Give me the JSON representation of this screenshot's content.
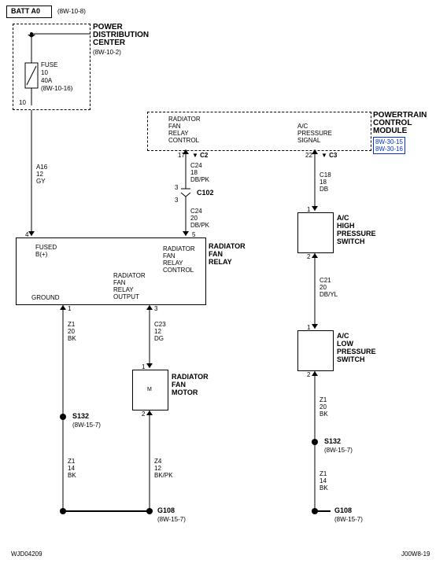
{
  "header": {
    "title": "BATT A0",
    "ref": "(8W-10-8)"
  },
  "pdc": {
    "title": "POWER\nDISTRIBUTION\nCENTER",
    "ref": "(8W-10-2)",
    "fuse": {
      "label": "FUSE",
      "num": "10",
      "rating": "40A",
      "ref": "(8W-10-16)",
      "pin": "10"
    }
  },
  "pcm": {
    "title": "POWERTRAIN\nCONTROL\nMODULE",
    "ref1": "8W-30-15",
    "ref2": "8W-30-16",
    "out1": {
      "label": "RADIATOR\nFAN\nRELAY\nCONTROL",
      "pin": "17",
      "conn": "C2"
    },
    "out2": {
      "label": "A/C\nPRESSURE\nSIGNAL",
      "pin": "22",
      "conn": "C3"
    }
  },
  "wires": {
    "w1": {
      "circuit": "A16",
      "gauge": "12",
      "color": "GY"
    },
    "w2": {
      "circuit": "C24",
      "gauge": "18",
      "color": "DB/PK"
    },
    "w3": {
      "circuit": "C18",
      "gauge": "18",
      "color": "DB"
    },
    "w4": {
      "circuit": "C24",
      "gauge": "20",
      "color": "DB/PK"
    },
    "w5": {
      "circuit": "C21",
      "gauge": "20",
      "color": "DB/YL"
    },
    "w6": {
      "circuit": "Z1",
      "gauge": "20",
      "color": "BK"
    },
    "w7": {
      "circuit": "C23",
      "gauge": "12",
      "color": "DG"
    },
    "w8": {
      "circuit": "Z1",
      "gauge": "20",
      "color": "BK"
    },
    "w9": {
      "circuit": "Z1",
      "gauge": "14",
      "color": "BK"
    },
    "w10": {
      "circuit": "Z4",
      "gauge": "12",
      "color": "BK/PK"
    },
    "w11": {
      "circuit": "Z1",
      "gauge": "14",
      "color": "BK"
    }
  },
  "c102": {
    "label": "C102",
    "pin_top": "3",
    "pin_bot": "3"
  },
  "relay": {
    "title": "RADIATOR\nFAN\nRELAY",
    "in1": {
      "label": "FUSED\nB(+)",
      "pin": "4"
    },
    "in2": {
      "label": "RADIATOR\nFAN\nRELAY\nCONTROL",
      "pin": "5"
    },
    "out1": {
      "label": "GROUND",
      "pin": "1"
    },
    "out2": {
      "label": "RADIATOR\nFAN\nRELAY\nOUTPUT",
      "pin": "3"
    }
  },
  "motor": {
    "title": "RADIATOR\nFAN\nMOTOR",
    "pin1": "1",
    "pin2": "2",
    "sym": "M"
  },
  "hp_switch": {
    "title": "A/C\nHIGH\nPRESSURE\nSWITCH",
    "pin1": "1",
    "pin2": "2"
  },
  "lp_switch": {
    "title": "A/C\nLOW\nPRESSURE\nSWITCH",
    "pin1": "1",
    "pin2": "2"
  },
  "splices": {
    "s132_l": {
      "label": "S132",
      "ref": "(8W-15-7)"
    },
    "s132_r": {
      "label": "S132",
      "ref": "(8W-15-7)"
    }
  },
  "grounds": {
    "g108_l": {
      "label": "G108",
      "ref": "(8W-15-7)"
    },
    "g108_r": {
      "label": "G108",
      "ref": "(8W-15-7)"
    }
  },
  "footer": {
    "left": "WJD04209",
    "right": "J00W8-19"
  }
}
